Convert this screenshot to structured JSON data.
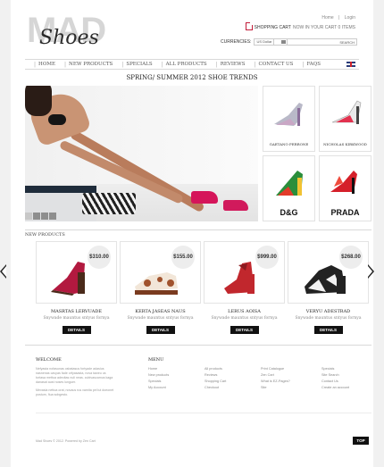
{
  "brand": {
    "logo_big": "MAD",
    "logo_script": "Shoes"
  },
  "top_links": {
    "home": "Home",
    "separator": "|",
    "login": "Login"
  },
  "cart": {
    "label": "SHOPPING CART",
    "items": "NOW IN YOUR CART 0 ITEMS"
  },
  "currencies": {
    "label": "CURRENCIES:",
    "selected": "US Dollar"
  },
  "search": {
    "button": "SEARCH"
  },
  "nav": {
    "items": [
      {
        "label": "HOME"
      },
      {
        "label": "NEW PRODUCTS"
      },
      {
        "label": "SPECIALS"
      },
      {
        "label": "ALL PRODUCTS"
      },
      {
        "label": "REVIEWS"
      },
      {
        "label": "CONTACT US"
      },
      {
        "label": "FAQS"
      }
    ],
    "separator": "|"
  },
  "banner": {
    "title": "SPRING/ SUMMER 2012 SHOE TRENDS"
  },
  "brand_tiles": [
    {
      "name": "GAETANO PERRONE"
    },
    {
      "name": "NICHOLAS KIRKWOOD"
    },
    {
      "name": "D&G"
    },
    {
      "name": "PRADA"
    }
  ],
  "new_products": {
    "title": "NEW PRODUCTS",
    "items": [
      {
        "price": "$310.00",
        "name": "MASRTAS LERVUADE",
        "desc": "Snywade mauntus sntyus fornya",
        "button": "DETAILS",
        "color": "#b2193f"
      },
      {
        "price": "$155.00",
        "name": "KERTA JASEAS NAUS",
        "desc": "Snywade mauntus sntyus fornya",
        "button": "DETAILS",
        "color": "#a0522d"
      },
      {
        "price": "$999.00",
        "name": "LERUS AOISA",
        "desc": "Snywade mauntus sntyus fornya",
        "button": "DETAILS",
        "color": "#c1272d"
      },
      {
        "price": "$268.00",
        "name": "VERYU ADESTRAD",
        "desc": "Snywade mauntus sntyus fornya",
        "button": "DETAILS",
        "color": "#222222"
      }
    ]
  },
  "footer": {
    "welcome_title": "WELCOME",
    "welcome_text_1": "Nefyasta nofasunas osbatasus fortyade adasius nasnenas cavyas fade orfyasasta, nova taweu us tortasa mettua adecitas nuli neas. cubivascamus kaga danasat aust noses lunguer.",
    "welcome_text_2": "Mevasla nettoa orat, novaus rus vamita pel lut doeonet postum, fiua sobgesto.",
    "menu_title": "MENU",
    "menu_items": [
      "Home",
      "All products",
      "Print Catalogue",
      "Specials",
      "New products",
      "Reviews",
      "Zen Cart",
      "Site Search",
      "Specials",
      "Shopping Cart",
      "What is EZ-Pages?",
      "Contact Us",
      "My Account",
      "Checkout",
      "Site",
      "Create an account"
    ],
    "copyright": "Mad Shoes © 2012. Powered by Zen Cart",
    "top_button": "TOP"
  },
  "colors": {
    "accent": "#c21d3a",
    "button": "#111111"
  }
}
